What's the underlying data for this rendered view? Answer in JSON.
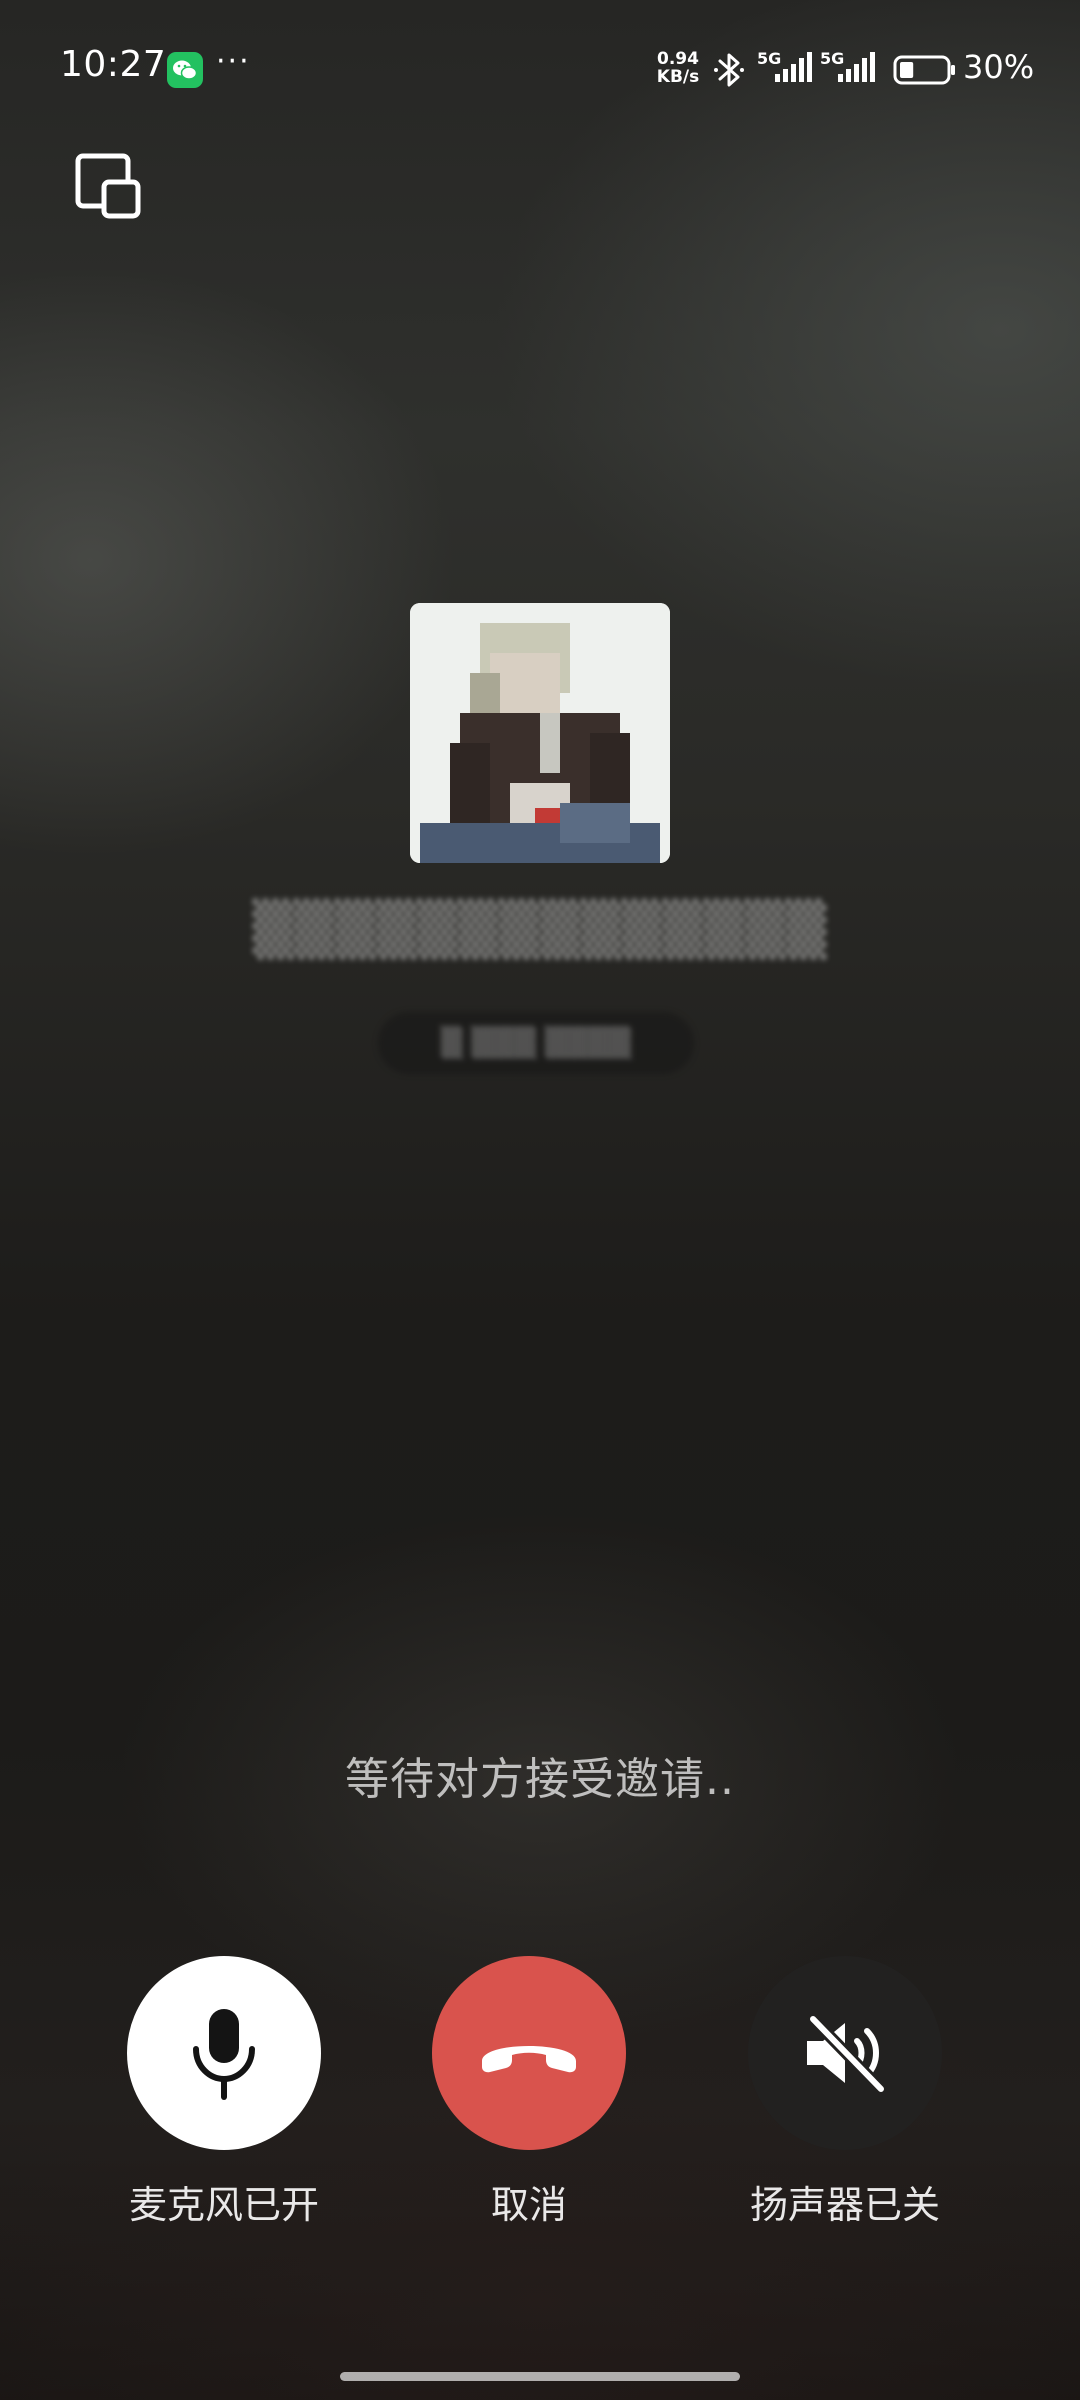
{
  "status_bar": {
    "time": "10:27",
    "app_icon": "wechat-icon",
    "more": "···",
    "net_speed_value": "0.94",
    "net_speed_unit": "KB/s",
    "signal_1_label": "5G",
    "signal_2_label": "5G",
    "battery_percent": "30%",
    "battery_level": 0.3
  },
  "call": {
    "status_text": "等待对方接受邀请.."
  },
  "controls": {
    "mic_label": "麦克风已开",
    "hangup_label": "取消",
    "speaker_label": "扬声器已关"
  },
  "colors": {
    "hangup": "#d9534d",
    "mic_button": "#ffffff",
    "speaker_button": "#222120",
    "wechat_green": "#23c160"
  }
}
